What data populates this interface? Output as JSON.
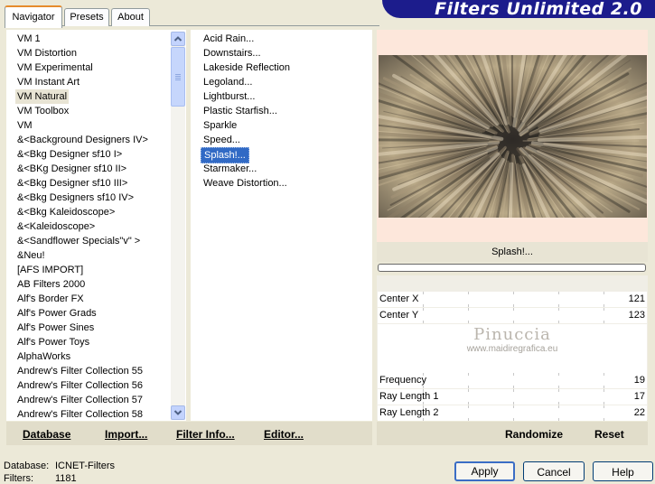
{
  "tabs": [
    "Navigator",
    "Presets",
    "About"
  ],
  "app_title": "Filters Unlimited 2.0",
  "categories": [
    "VM 1",
    "VM Distortion",
    "VM Experimental",
    "VM Instant Art",
    "VM Natural",
    "VM Toolbox",
    "VM",
    "&<Background Designers IV>",
    "&<Bkg Designer sf10 I>",
    "&<BKg Designer sf10 II>",
    "&<Bkg Designer sf10 III>",
    "&<Bkg Designers sf10 IV>",
    "&<Bkg Kaleidoscope>",
    "&<Kaleidoscope>",
    "&<Sandflower Specials\"v\" >",
    "&Neu!",
    "[AFS IMPORT]",
    "AB Filters 2000",
    "Alf's Border FX",
    "Alf's Power Grads",
    "Alf's Power Sines",
    "Alf's Power Toys",
    "AlphaWorks",
    "Andrew's Filter Collection 55",
    "Andrew's Filter Collection 56",
    "Andrew's Filter Collection 57",
    "Andrew's Filter Collection 58"
  ],
  "selected_category": "VM Natural",
  "filters": [
    "Acid Rain...",
    "Downstairs...",
    "Lakeside Reflection",
    "Legoland...",
    "Lightburst...",
    "Plastic Starfish...",
    "Sparkle",
    "Speed...",
    "Splash!...",
    "Starmaker...",
    "Weave Distortion..."
  ],
  "selected_filter": "Splash!...",
  "left_buttons": [
    "Database",
    "Import...",
    "Filter Info...",
    "Editor..."
  ],
  "preview_label": "Splash!...",
  "params_top": [
    {
      "label": "Center X",
      "value": "121"
    },
    {
      "label": "Center Y",
      "value": "123"
    }
  ],
  "params_bottom": [
    {
      "label": "Frequency",
      "value": "19"
    },
    {
      "label": "Ray Length 1",
      "value": "17"
    },
    {
      "label": "Ray Length 2",
      "value": "22"
    }
  ],
  "watermark": {
    "name": "Pinuccia",
    "url": "www.maidiregrafica.eu"
  },
  "right_buttons": [
    "Randomize",
    "Reset"
  ],
  "status": {
    "db_label": "Database:",
    "db_value": "ICNET-Filters",
    "filters_label": "Filters:",
    "filters_value": "1181"
  },
  "dialog_buttons": [
    "Apply",
    "Cancel",
    "Help"
  ],
  "colors": {
    "banner": "#1C1C8C",
    "selection": "#316AC5",
    "tab_accent": "#E68B2C"
  }
}
